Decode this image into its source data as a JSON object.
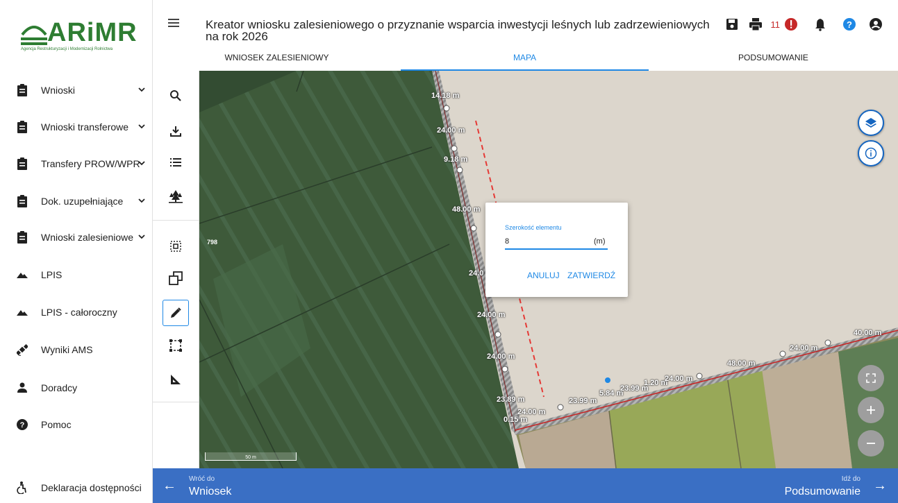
{
  "logo": {
    "text": "ARiMR",
    "subtitle": "Agencja Restrukturyzacji i Modernizacji Rolnictwa"
  },
  "sidebar": {
    "items": [
      {
        "label": "Wnioski",
        "icon": "clipboard-icon",
        "has_chevron": true
      },
      {
        "label": "Wnioski transferowe",
        "icon": "clipboard-icon",
        "has_chevron": true
      },
      {
        "label": "Transfery PROW/WPR",
        "icon": "clipboard-icon",
        "has_chevron": true
      },
      {
        "label": "Dok. uzupełniające",
        "icon": "clipboard-icon",
        "has_chevron": true
      },
      {
        "label": "Wnioski zalesieniowe",
        "icon": "clipboard-icon",
        "has_chevron": true
      },
      {
        "label": "LPIS",
        "icon": "mountain-icon",
        "has_chevron": false
      },
      {
        "label": "LPIS - całoroczny",
        "icon": "mountain-icon",
        "has_chevron": false
      },
      {
        "label": "Wyniki AMS",
        "icon": "satellite-icon",
        "has_chevron": false
      },
      {
        "label": "Doradcy",
        "icon": "person-icon",
        "has_chevron": false
      },
      {
        "label": "Pomoc",
        "icon": "help-circle-icon",
        "has_chevron": false
      }
    ],
    "footer_label": "Deklaracja dostępności"
  },
  "header": {
    "title": "Kreator wniosku zalesieniowego o przyznanie wsparcia inwestycji leśnych lub zadrzewieniowych na rok 2026",
    "notification_count": "11",
    "icons": [
      "save-icon",
      "print-icon",
      "alert-icon",
      "bell-icon",
      "help-icon",
      "account-icon"
    ]
  },
  "tabs": [
    {
      "label": "WNIOSEK ZALESIENIOWY",
      "active": false
    },
    {
      "label": "MAPA",
      "active": true
    },
    {
      "label": "PODSUMOWANIE",
      "active": false
    }
  ],
  "tools": [
    "search-icon",
    "download-icon",
    "list-icon",
    "trees-icon",
    "select-area-icon",
    "copy-polygon-icon",
    "pencil-icon",
    "rectangle-select-icon",
    "ruler-angle-icon"
  ],
  "map": {
    "field_number": "798",
    "scale_label": "50 m",
    "measurements": [
      "14.18 m",
      "24.00 m",
      "9.18 m",
      "48.00 m",
      "24.0",
      "24.00 m",
      "24.00 m",
      "23.89 m",
      "24.00 m",
      "0.15 m",
      "23.99 m",
      "5.84 m",
      "23.99 m",
      "1.20 m",
      "24.00 m",
      "48.00 m",
      "24.00 m",
      "40.00 m"
    ]
  },
  "dialog": {
    "label": "Szerokość elementu",
    "value": "8",
    "unit": "(m)",
    "cancel": "ANULUJ",
    "confirm": "ZATWIERDŹ"
  },
  "footer": {
    "back_small": "Wróć do",
    "back_big": "Wniosek",
    "next_small": "Idź do",
    "next_big": "Podsumowanie"
  },
  "colors": {
    "accent": "#1e88e5",
    "footer": "#3a6fc4",
    "brand": "#2e7d32",
    "alert": "#c62828"
  }
}
